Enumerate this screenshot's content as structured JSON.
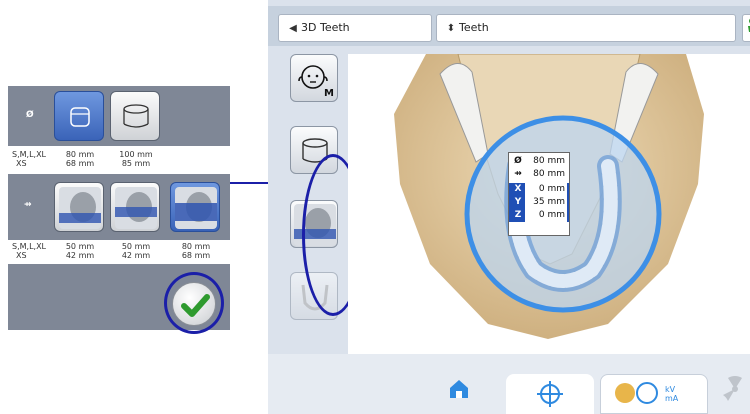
{
  "app": {
    "header": {
      "volume_type": "3D Teeth",
      "region": "Teeth"
    },
    "sidebar": [
      {
        "name": "patient-head",
        "label": "M"
      },
      {
        "name": "cylinder",
        "label": ""
      },
      {
        "name": "head-position",
        "label": ""
      },
      {
        "name": "arch",
        "label": ""
      }
    ],
    "info_box": {
      "diameter": "80 mm",
      "height": "80 mm",
      "x": {
        "key": "X",
        "value": "0 mm"
      },
      "y": {
        "key": "Y",
        "value": "35 mm"
      },
      "z": {
        "key": "Z",
        "value": "0 mm"
      }
    },
    "bottom_tabs": [
      {
        "name": "home"
      },
      {
        "name": "target"
      },
      {
        "name": "patient-kv-ma",
        "label": "kV mA"
      },
      {
        "name": "radiation"
      }
    ]
  },
  "callout": {
    "diameter_symbol": "Ø",
    "height_symbol": "⇸",
    "diameter_options": [
      {
        "sizes": "S,M,L,XL\nXS",
        "value": "80 mm\n68 mm",
        "selected": true
      },
      {
        "sizes": "",
        "value": "100 mm\n85 mm",
        "selected": false
      }
    ],
    "size_label": "S,M,L,XL",
    "size_label_2": "XS",
    "fov1": {
      "a": "80 mm",
      "b": "68 mm"
    },
    "fov2": {
      "a": "100 mm",
      "b": "85 mm"
    },
    "hfov1": {
      "a": "50 mm",
      "b": "42 mm"
    },
    "hfov2": {
      "a": "50 mm",
      "b": "42 mm"
    },
    "hfov3": {
      "a": "80 mm",
      "b": "68 mm"
    }
  },
  "colors": {
    "panel_gray": "#7f8796",
    "selected_blue": "#3a63b8",
    "highlight_ring": "#1b1fa8",
    "fov_circle": "#3d8fe6",
    "check_green": "#2e9a2e"
  }
}
